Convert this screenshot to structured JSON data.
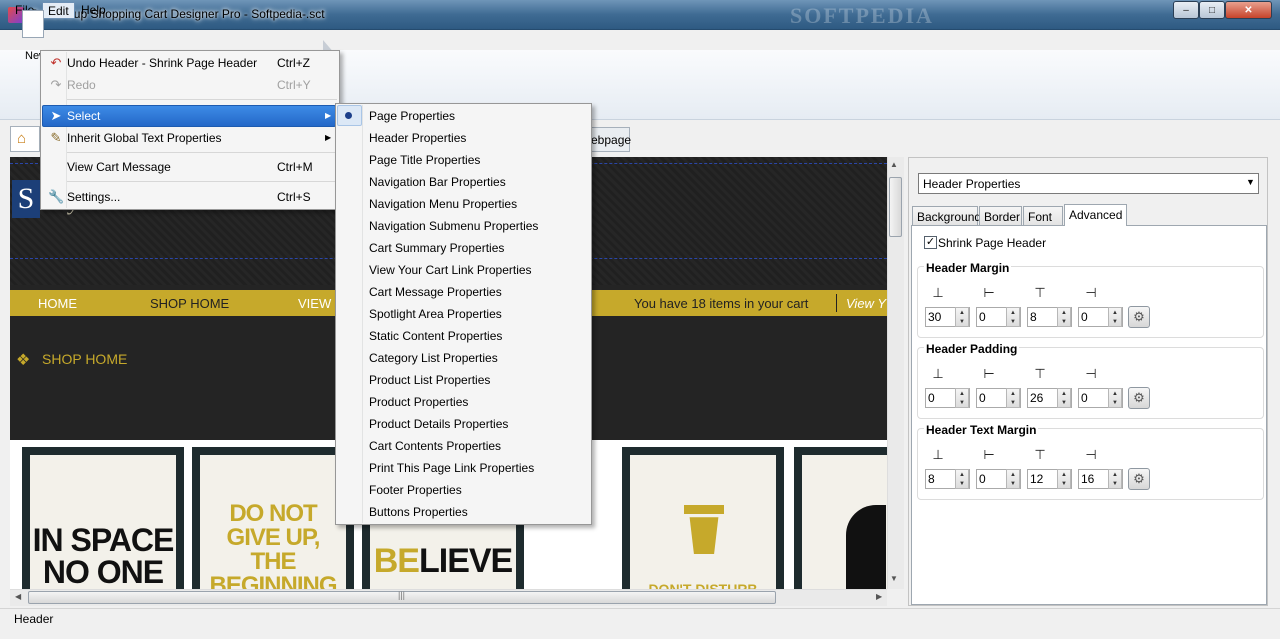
{
  "window": {
    "title": "CoffeeCup Shopping Cart Designer Pro - Softpedia-.sct",
    "watermark": "SOFTPEDIA",
    "minimize": "–",
    "maximize": "□",
    "close": "✕"
  },
  "menubar": {
    "file": "File",
    "edit": "Edit",
    "help": "Help"
  },
  "toolbar": {
    "new_label": "New"
  },
  "tabs": {
    "webpage": "ebpage"
  },
  "edit_menu": {
    "undo": {
      "label": "Undo Header - Shrink Page Header",
      "shortcut": "Ctrl+Z"
    },
    "redo": {
      "label": "Redo",
      "shortcut": "Ctrl+Y"
    },
    "select": {
      "label": "Select"
    },
    "inherit": {
      "label": "Inherit Global Text Properties"
    },
    "view_cart": {
      "label": "View Cart Message",
      "shortcut": "Ctrl+M"
    },
    "settings": {
      "label": "Settings...",
      "shortcut": "Ctrl+S"
    }
  },
  "select_submenu": [
    "Page Properties",
    "Header Properties",
    "Page Title Properties",
    "Navigation Bar Properties",
    "Navigation Menu Properties",
    "Navigation Submenu Properties",
    "Cart Summary Properties",
    "View Your Cart Link Properties",
    "Cart Message Properties",
    "Spotlight Area Properties",
    "Static Content Properties",
    "Category List Properties",
    "Product List Properties",
    "Product Properties",
    "Product Details Properties",
    "Cart Contents Properties",
    "Print This Page Link Properties",
    "Footer Properties",
    "Buttons Properties"
  ],
  "preview": {
    "logo_letter": "S",
    "logo_script": "ny store",
    "nav": {
      "home": "HOME",
      "shop_home": "SHOP HOME",
      "view": "VIEW",
      "cart_summary": "You have 18 items in your cart",
      "view_cart": "View Y"
    },
    "section_title": "SHOP HOME",
    "products": {
      "p1": "IN SPACE NO ONE",
      "p2_l1": "DO NOT",
      "p2_l2": "GIVE UP,",
      "p2_l3": "THE BEGINNING",
      "p3_a": "BE",
      "p3_b": "LIEVE",
      "p4": "DON'T DISTURB"
    }
  },
  "panel": {
    "selected": "Header Properties",
    "tabs": {
      "background": "Background",
      "border": "Border",
      "font": "Font",
      "advanced": "Advanced"
    },
    "shrink_label": "Shrink Page Header",
    "shrink_checked": true,
    "groups": [
      {
        "title": "Header Margin",
        "values": [
          "30",
          "0",
          "8",
          "0"
        ]
      },
      {
        "title": "Header Padding",
        "values": [
          "0",
          "0",
          "26",
          "0"
        ]
      },
      {
        "title": "Header Text Margin",
        "values": [
          "8",
          "0",
          "12",
          "16"
        ]
      }
    ]
  },
  "status": {
    "text": "Header"
  },
  "icons": {
    "undo": "undo-icon",
    "redo": "redo-icon",
    "select": "cursor-icon",
    "inherit": "inherit-text-icon",
    "settings": "wrench-icon",
    "home": "home-icon",
    "shop": "box-icon",
    "reset": "gear-icon"
  },
  "colors": {
    "nav_gold": "#c6a92b",
    "menu_highlight": "#2468c8",
    "logo_blue": "#1c3f78"
  }
}
